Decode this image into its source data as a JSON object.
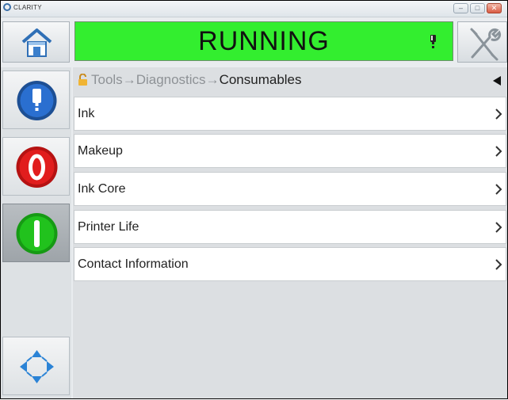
{
  "window": {
    "title": "CLARITY",
    "minimize_glyph": "–",
    "maximize_glyph": "□",
    "close_glyph": "✕"
  },
  "status": {
    "text": "RUNNING",
    "color": "#33ee2f",
    "alert_icon": "ink-drop-alert-icon"
  },
  "toolbar": {
    "home_icon": "home-icon",
    "tools_icon": "tools-icon"
  },
  "sidebar": {
    "items": [
      {
        "icon": "ink-system-icon",
        "color": "#2a6fd0"
      },
      {
        "icon": "stop-icon",
        "color": "#e11d1d"
      },
      {
        "icon": "start-icon",
        "color": "#21c21d",
        "active": true
      },
      {
        "icon": "navigation-arrows-icon",
        "color": "#2b83d6"
      }
    ]
  },
  "breadcrumb": {
    "icon": "lock-icon",
    "path": [
      "Tools",
      "Diagnostics"
    ],
    "separator": "→",
    "current": "Consumables"
  },
  "menu": {
    "items": [
      {
        "label": "Ink"
      },
      {
        "label": "Makeup"
      },
      {
        "label": "Ink Core"
      },
      {
        "label": "Printer Life"
      },
      {
        "label": "Contact Information"
      }
    ]
  }
}
